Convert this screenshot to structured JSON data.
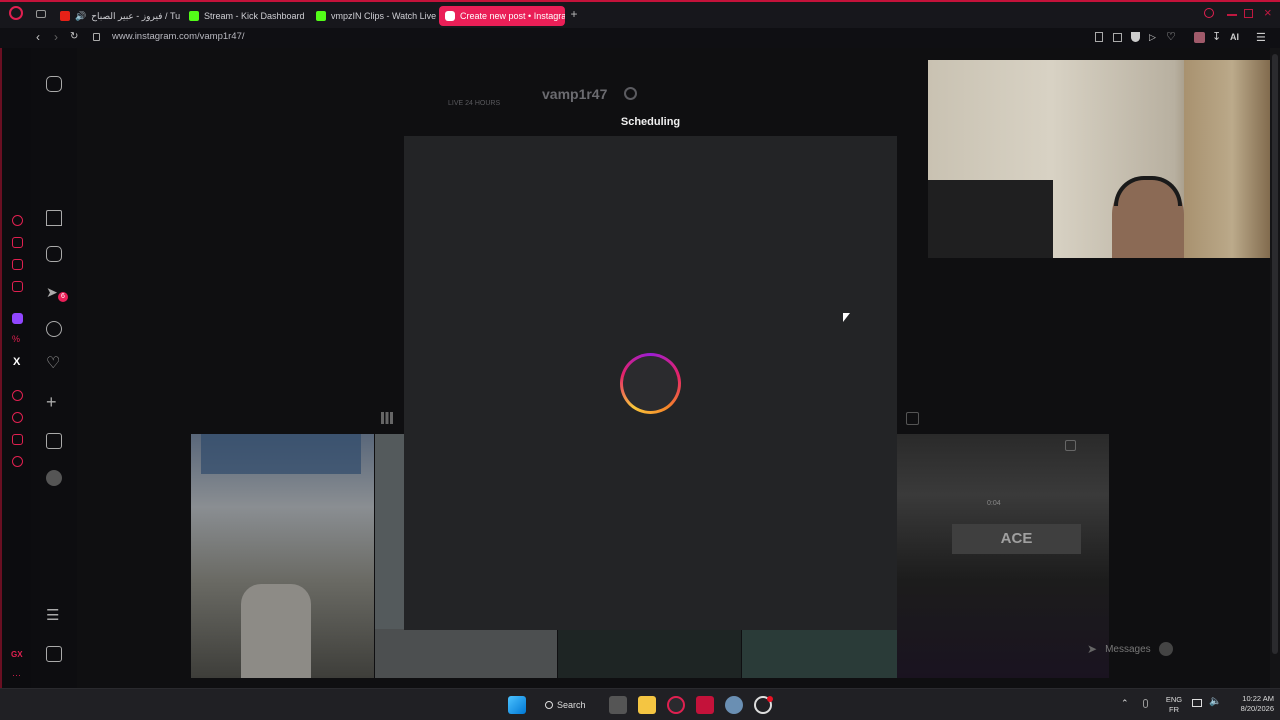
{
  "browser": {
    "tabs": [
      {
        "label": "فيروز - عبير الصباح / Tube",
        "icon": "youtube-icon",
        "color": "#e62117"
      },
      {
        "label": "Stream - Kick Dashboard",
        "icon": "kick-icon",
        "color": "#53fc18"
      },
      {
        "label": "vmpzIN Clips - Watch Live",
        "icon": "kick-icon",
        "color": "#53fc18"
      },
      {
        "label": "Create new post • Instagra",
        "icon": "instagram-icon",
        "color": "#ea1f57"
      }
    ],
    "url": "www.instagram.com/vamp1r47/",
    "ai_label": "AI"
  },
  "profile": {
    "live_label": "LIVE 24 HOURS",
    "username": "vamp1r47"
  },
  "modal": {
    "title": "Scheduling",
    "state": "loading"
  },
  "reel": {
    "ace_label": "ACE",
    "time_text": "0:04"
  },
  "messages": {
    "label": "Messages",
    "badge": "6"
  },
  "sidebar_badge": "6",
  "taskbar": {
    "search_label": "Search",
    "lang_top": "ENG",
    "lang_bottom": "FR",
    "time": "10:22 AM",
    "date": "8/20/2026"
  },
  "colors": {
    "accent": "#ea1f57",
    "opera_red": "#c4123a",
    "modal_bg": "#232426"
  }
}
